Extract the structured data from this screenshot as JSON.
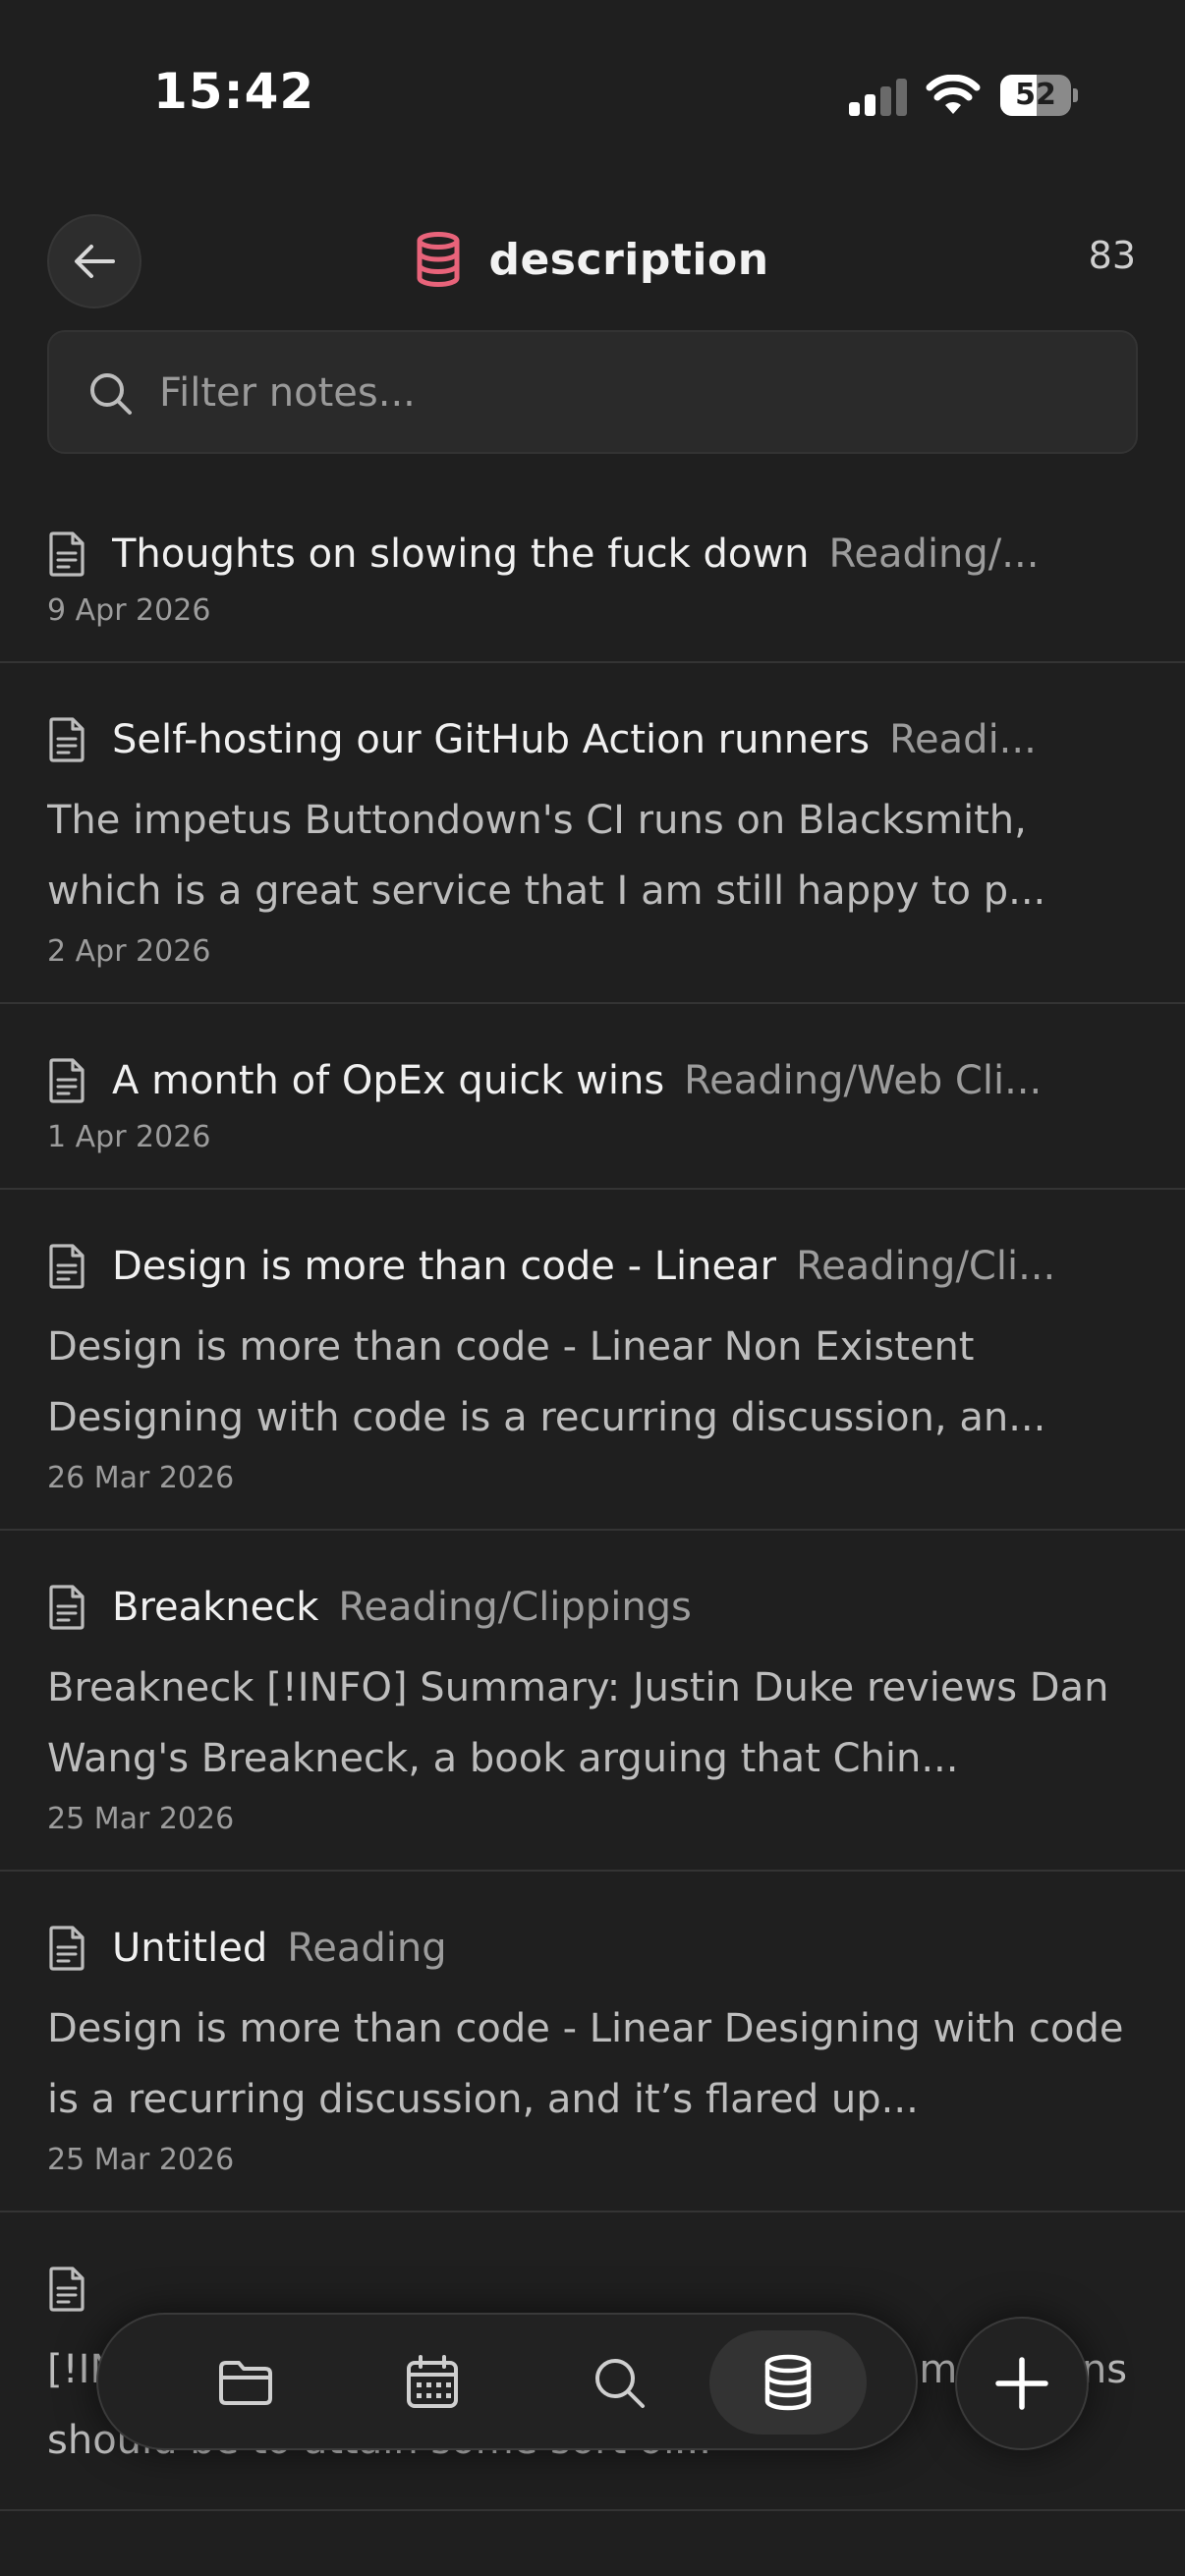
{
  "status_bar": {
    "time": "15:42",
    "battery_level": "52",
    "battery_fraction": 0.52,
    "signal_bars_active": 2,
    "signal_bars_total": 4
  },
  "header": {
    "title": "description",
    "count": "83",
    "icon": "database-icon",
    "icon_color": "#e8637a"
  },
  "search": {
    "placeholder": "Filter notes...",
    "value": ""
  },
  "notes": [
    {
      "title": "Thoughts on slowing the fuck down",
      "folder": "Reading/...",
      "preview": "",
      "date": "9 Apr 2026"
    },
    {
      "title": "Self-hosting our GitHub Action runners",
      "folder": "Readi...",
      "preview": "The impetus Buttondown's CI runs on Blacksmith, which is a great service that I am still happy to p...",
      "date": "2 Apr 2026"
    },
    {
      "title": "A month of OpEx quick wins",
      "folder": "Reading/Web Cli...",
      "preview": "",
      "date": "1 Apr 2026"
    },
    {
      "title": "Design is more than code - Linear",
      "folder": "Reading/Cli...",
      "preview": "Design is more than code - Linear Non Existent Designing with code is a recurring discussion, an...",
      "date": "26 Mar 2026"
    },
    {
      "title": "Breakneck",
      "folder": "Reading/Clippings",
      "preview": "Breakneck [!INFO] Summary: Justin Duke reviews Dan Wang's Breakneck, a book arguing that Chin...",
      "date": "25 Mar 2026"
    },
    {
      "title": "Untitled",
      "folder": "Reading",
      "preview": "Design is more than code - Linear Designing with code is a recurring discussion, and it’s flared up...",
      "date": "25 Mar 2026"
    },
    {
      "title": "",
      "folder": "",
      "preview": "[!INFO] The goal of climbing big, dangerous mountains should be to attain some sort of...",
      "date": ""
    }
  ],
  "tab_bar": {
    "tabs": [
      {
        "icon": "folder-icon",
        "active": false
      },
      {
        "icon": "calendar-icon",
        "active": false
      },
      {
        "icon": "search-icon",
        "active": false
      },
      {
        "icon": "database-icon",
        "active": true
      }
    ],
    "add_icon": "plus-icon"
  },
  "colors": {
    "background": "#1f1f1f",
    "accent": "#e8637a",
    "text_primary": "#f0f0f0",
    "text_secondary": "#9c9c9c"
  }
}
